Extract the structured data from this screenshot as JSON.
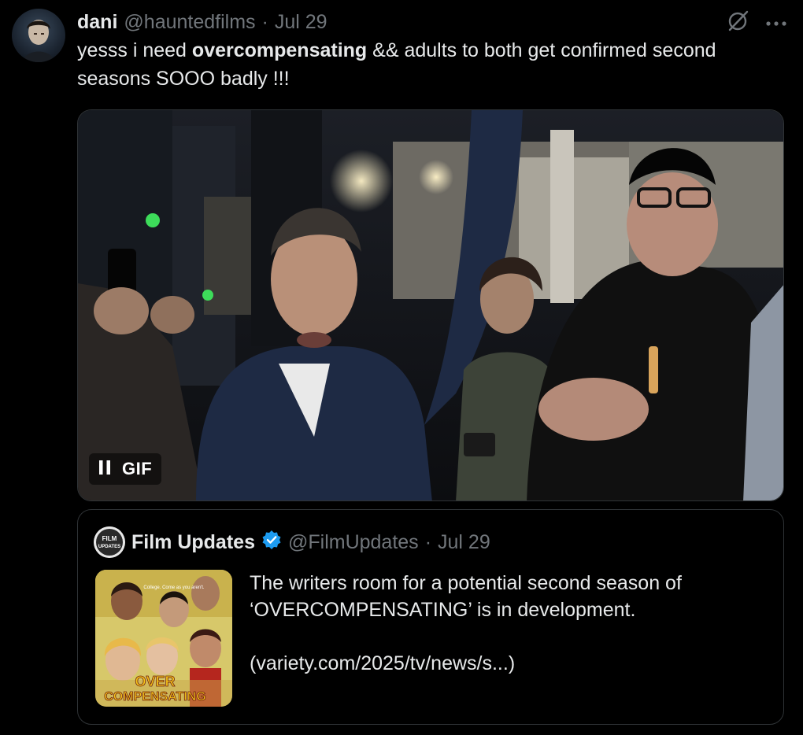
{
  "tweet": {
    "author": {
      "display_name": "dani",
      "handle": "@hauntedfilms",
      "date": "Jul 29"
    },
    "text_parts": {
      "before": "yesss i need ",
      "bold": "overcompensating",
      "after": " && adults to both get confirmed second seasons SOOO badly !!!"
    },
    "actions": {
      "grok_icon": "grok-icon",
      "more_icon": "more-icon",
      "more_label": "···"
    },
    "media": {
      "type": "gif",
      "gif_label": "GIF",
      "paused": false
    }
  },
  "quote": {
    "author": {
      "display_name": "Film Updates",
      "handle": "@FilmUpdates",
      "date": "Jul 29",
      "verified": true,
      "avatar_text": [
        "FILM",
        "UPDATES"
      ]
    },
    "paragraphs": [
      "The writers room for a potential second season of ‘OVERCOMPENSATING’ is in development.",
      "(variety.com/2025/tv/news/s...)"
    ],
    "thumbnail": {
      "title_lines": [
        "OVER",
        "COMPENSATING"
      ],
      "tagline": "College. Come as you aren't."
    }
  },
  "colors": {
    "background": "#000000",
    "text": "#e7e9ea",
    "secondary": "#71767b",
    "border": "#2f3336",
    "verified": "#1d9bf0",
    "poster_yellow": "#f5c518"
  }
}
